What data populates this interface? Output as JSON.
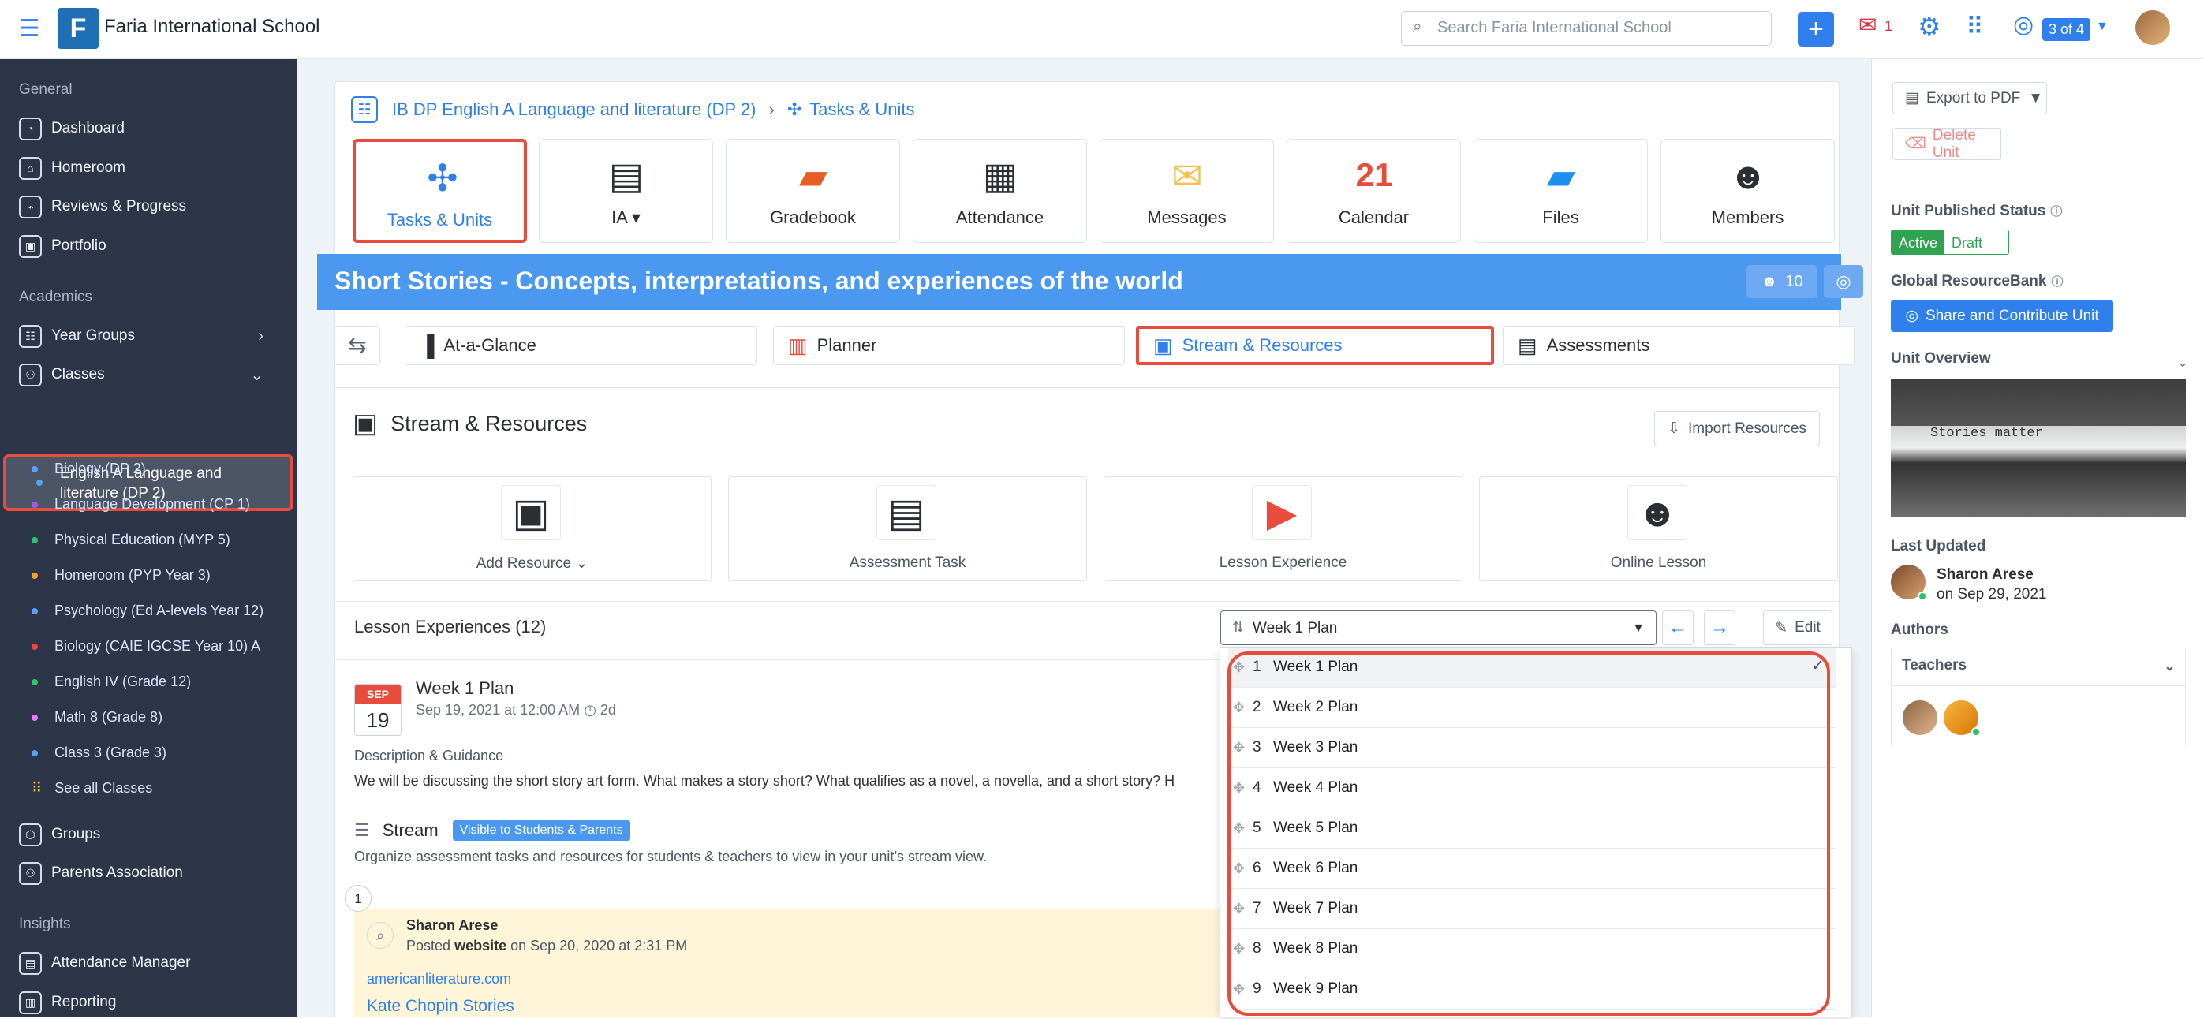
{
  "header": {
    "school": "Faria International School",
    "search_placeholder": "Search Faria International School",
    "mail_count": "1",
    "pager": "3 of 4"
  },
  "sidebar": {
    "general": "General",
    "items": [
      "Dashboard",
      "Homeroom",
      "Reviews & Progress",
      "Portfolio"
    ],
    "academics": "Academics",
    "year_groups": "Year Groups",
    "classes_label": "Classes",
    "selected_class": "English A Language and literature (DP 2)",
    "classes": [
      {
        "name": "Biology (DP 2)",
        "color": "#5aa1f5"
      },
      {
        "name": "Language Development (CP 1)",
        "color": "#9b5de5"
      },
      {
        "name": "Physical Education (MYP 5)",
        "color": "#30c36c"
      },
      {
        "name": "Homeroom (PYP Year 3)",
        "color": "#f59f2d"
      },
      {
        "name": "Psychology (Ed A-levels Year 12)",
        "color": "#5aa1f5"
      },
      {
        "name": "Biology (CAIE IGCSE Year 10) A",
        "color": "#ef4444"
      },
      {
        "name": "English IV (Grade 12)",
        "color": "#30c36c"
      },
      {
        "name": "Math 8 (Grade 8)",
        "color": "#e879f9"
      },
      {
        "name": "Class 3 (Grade 3)",
        "color": "#5aa1f5"
      }
    ],
    "see_all": "See all Classes",
    "groups": "Groups",
    "parents": "Parents Association",
    "insights": "Insights",
    "attendance_manager": "Attendance Manager",
    "reporting": "Reporting"
  },
  "main": {
    "breadcrumb_course": "IB DP English A Language and literature (DP 2)",
    "breadcrumb_current": "Tasks & Units",
    "tiles": [
      "Tasks & Units",
      "IA",
      "Gradebook",
      "Attendance",
      "Messages",
      "Calendar",
      "Files",
      "Members"
    ],
    "unit_title": "Short Stories - Concepts, interpretations, and experiences of the world",
    "unit_members": "10",
    "tabs": [
      "At-a-Glance",
      "Planner",
      "Stream & Resources",
      "Assessments"
    ],
    "section_title": "Stream & Resources",
    "import": "Import Resources",
    "cards": [
      "Add Resource",
      "Assessment Task",
      "Lesson Experience",
      "Online Lesson"
    ],
    "lesson_experiences": "Lesson Experiences (12)",
    "selected_week": "Week 1 Plan",
    "edit": "Edit",
    "month": "SEP",
    "day": "19",
    "week_title": "Week 1 Plan",
    "week_date": "Sep 19, 2021 at 12:00 AM",
    "week_duration": "2d",
    "guidance_heading": "Description & Guidance",
    "guidance": "We will be discussing the short story art form. What makes a story short? What qualifies as a novel, a novella, and a short story? H",
    "stream_title": "Stream",
    "stream_badge": "Visible to Students & Parents",
    "stream_desc": "Organize assessment tasks and resources for students & teachers to view in your unit’s stream view.",
    "post_number": "1",
    "poster": "Sharon Arese",
    "posted_prefix": "Posted",
    "posted_type": "website",
    "posted_date": "on Sep 20, 2020 at 2:31 PM",
    "site": "americanliterature.com",
    "link": "Kate Chopin Stories"
  },
  "week_options": [
    "Week 1 Plan",
    "Week 2 Plan",
    "Week 3 Plan",
    "Week 4 Plan",
    "Week 5 Plan",
    "Week 6 Plan",
    "Week 7 Plan",
    "Week 8 Plan",
    "Week 9 Plan"
  ],
  "right_panel": {
    "export": "Export to PDF",
    "delete": "Delete Unit",
    "published_status": "Unit Published Status",
    "active": "Active",
    "draft": "Draft",
    "global_bank": "Global ResourceBank",
    "share": "Share and Contribute Unit",
    "overview": "Unit Overview",
    "overview_text": "Stories matter",
    "last_updated": "Last Updated",
    "updated_by": "Sharon Arese",
    "updated_date": "on Sep 29, 2021",
    "authors": "Authors",
    "teachers": "Teachers"
  },
  "colors": {
    "accent": "#2f80ed",
    "highlight": "#e74c3c",
    "sidebar": "#2d3648",
    "active": "#2fa34f"
  }
}
